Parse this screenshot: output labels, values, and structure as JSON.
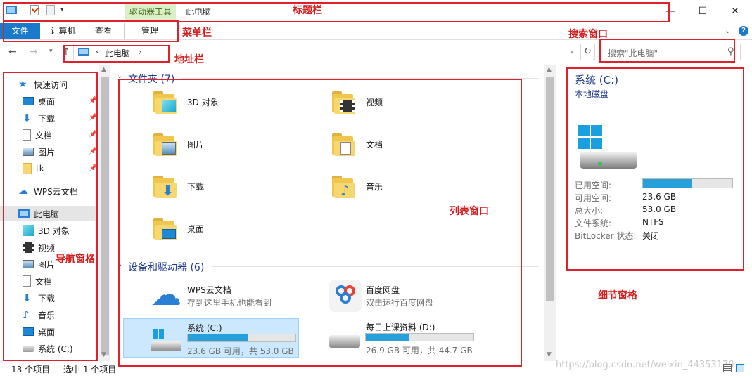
{
  "title_bar": {
    "contextual_tab": "驱动器工具",
    "window_title": "此电脑",
    "minimize": "—",
    "maximize": "☐",
    "close": "✕"
  },
  "ribbon": {
    "tabs": [
      "文件",
      "计算机",
      "查看",
      "管理"
    ]
  },
  "address": {
    "path_sep": "›",
    "location": "此电脑",
    "search_placeholder": "搜索\"此电脑\""
  },
  "nav": {
    "quick_access": "快速访问",
    "quick_items": [
      "桌面",
      "下载",
      "文档",
      "图片",
      "tk"
    ],
    "wps": "WPS云文档",
    "this_pc": "此电脑",
    "pc_items": [
      "3D 对象",
      "视频",
      "图片",
      "文档",
      "下载",
      "音乐",
      "桌面",
      "系统 (C:)"
    ]
  },
  "content": {
    "folders_header": "文件夹 (7)",
    "folders": [
      "3D 对象",
      "视频",
      "图片",
      "文档",
      "下载",
      "音乐",
      "桌面"
    ],
    "devices_header": "设备和驱动器 (6)",
    "devices": [
      {
        "name": "WPS云文档",
        "sub": "存到这里手机也能看到"
      },
      {
        "name": "百度网盘",
        "sub": "双击运行百度网盘"
      },
      {
        "name": "系统 (C:)",
        "sub": "23.6 GB 可用，共 53.0 GB"
      },
      {
        "name": "每日上课资料 (D:)",
        "sub": "26.9 GB 可用，共 44.7 GB"
      }
    ]
  },
  "drive_usage": {
    "c": 0.555,
    "d": 0.398
  },
  "details": {
    "title": "系统 (C:)",
    "subtitle": "本地磁盘",
    "used_label": "已用空间:",
    "free_label": "可用空间:",
    "free_val": "23.6 GB",
    "total_label": "总大小:",
    "total_val": "53.0 GB",
    "fs_label": "文件系统:",
    "fs_val": "NTFS",
    "bitlocker_label": "BitLocker 状态:",
    "bitlocker_val": "关闭"
  },
  "status": {
    "count": "13 个项目",
    "selected": "选中 1 个项目"
  },
  "annotations": {
    "title_bar": "标题栏",
    "menu_bar": "菜单栏",
    "search_window": "搜索窗口",
    "address_bar": "地址栏",
    "list_window": "列表窗口",
    "nav_pane": "导航窗格",
    "detail_pane": "细节窗格"
  },
  "watermark": "https://blog.csdn.net/weixin_44353170",
  "colors": {
    "accent": "#1979ca",
    "annot": "#e0202a",
    "folder": "#f1c64e",
    "drive_fill": "#26a0da"
  }
}
